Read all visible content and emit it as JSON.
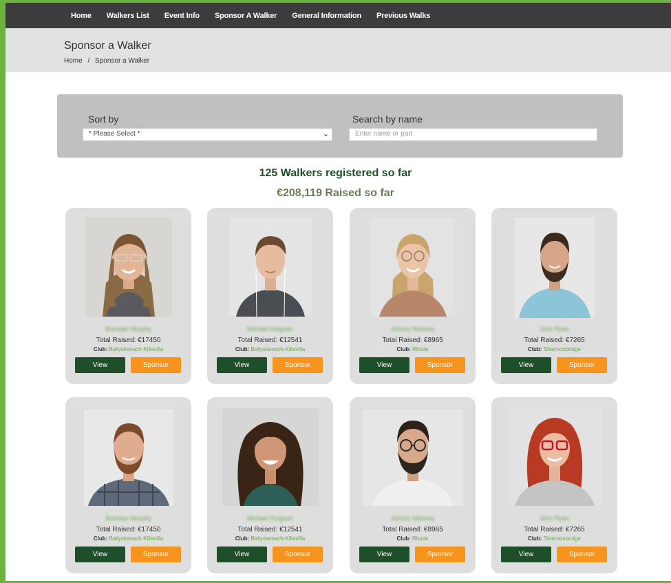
{
  "nav": {
    "items": [
      "Home",
      "Walkers List",
      "Event Info",
      "Sponsor A Walker",
      "General Information",
      "Previous Walks"
    ]
  },
  "header": {
    "title": "Sponsor a Walker",
    "breadcrumb": [
      "Home",
      "/",
      "Sponsor a Walker"
    ]
  },
  "filters": {
    "sort_label": "Sort by",
    "sort_value": "* Please Select *",
    "search_label": "Search by name",
    "search_placeholder": "Enter name or part"
  },
  "stats": {
    "registered": "125 Walkers registered so far",
    "raised": "€208,119 Raised so far"
  },
  "labels": {
    "club": "Club:",
    "view": "View",
    "sponsor": "Sponsor"
  },
  "walkers": [
    {
      "name": "Brendan Murphy",
      "total": "Total Raised: €17450",
      "club": "Ballyskenach-Killavilla",
      "photo": "woman-glasses-photo"
    },
    {
      "name": "Michael Duignan",
      "total": "Total Raised: €12541",
      "club": "Ballyskenach-Killavilla",
      "photo": "young-man-earphones-photo"
    },
    {
      "name": "Johnny Mooney",
      "total": "Total Raised: €8965",
      "club": "Rhode",
      "photo": "blonde-woman-glasses-photo"
    },
    {
      "name": "John Ryan",
      "total": "Total Raised: €7265",
      "club": "Shannonbridge",
      "photo": "bearded-man-photo"
    },
    {
      "name": "Brendan Murphy",
      "total": "Total Raised: €17450",
      "club": "Ballyskenach-Killavilla",
      "photo": "bearded-man-plaid-photo"
    },
    {
      "name": "Michael Duignan",
      "total": "Total Raised: €12541",
      "club": "Ballyskenach-Killavilla",
      "photo": "curly-hair-woman-photo"
    },
    {
      "name": "Johnny Mooney",
      "total": "Total Raised: €8965",
      "club": "Rhode",
      "photo": "man-glasses-beard-photo"
    },
    {
      "name": "John Ryan",
      "total": "Total Raised: €7265",
      "club": "Shannonbridge",
      "photo": "red-hair-woman-photo"
    }
  ],
  "colors": {
    "frame": "#6cb33f",
    "nav_bg": "#3c3c3c",
    "view_button": "#1e4e2a",
    "sponsor_button": "#f7941d",
    "club_text": "#6aa84f"
  }
}
